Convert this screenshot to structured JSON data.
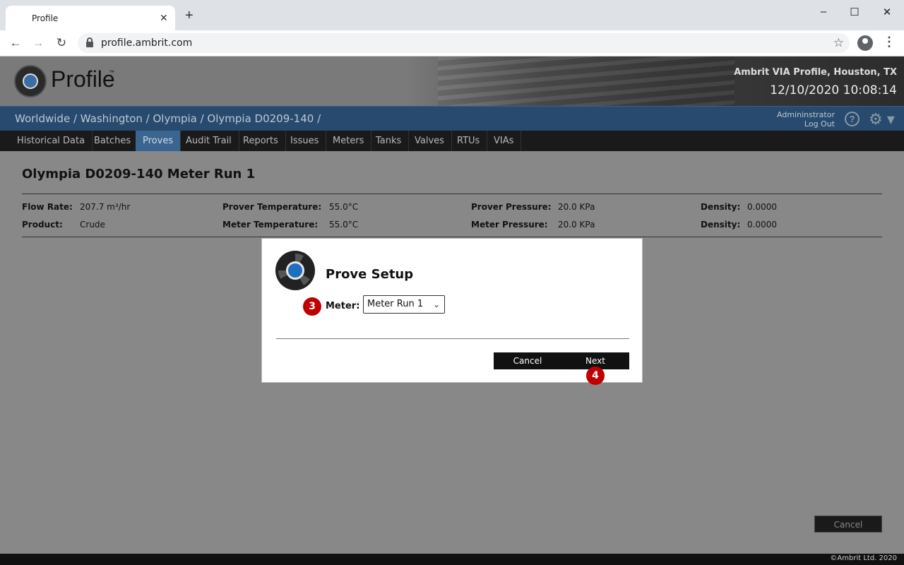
{
  "browser": {
    "tab_title": "Profile",
    "tab_close": "✕",
    "new_tab": "+",
    "url": "profile.ambrit.com",
    "window_controls": {
      "minimize": "–",
      "maximize": "☐",
      "close": "✕"
    },
    "nav": {
      "back": "←",
      "forward": "→",
      "reload": "↻"
    },
    "star": "☆",
    "menu": "⋮"
  },
  "header": {
    "logo_text": "Profile",
    "logo_tm": "™",
    "site_name": "Ambrit VIA Profile, Houston, TX",
    "datetime": "12/10/2020 10:08:14"
  },
  "breadcrumb": "Worldwide / Washington / Olympia / Olympia D0209-140 /",
  "user": {
    "name": "Admininstrator",
    "logout": "Log Out",
    "help": "?",
    "gear": "⚙ ▾"
  },
  "menu": [
    {
      "label": "Historical Data",
      "active": false
    },
    {
      "label": "Batches",
      "active": false
    },
    {
      "label": "Proves",
      "active": true
    },
    {
      "label": "Audit Trail",
      "active": false
    },
    {
      "label": "Reports",
      "active": false
    },
    {
      "label": "Issues",
      "active": false
    },
    {
      "label": "Meters",
      "active": false
    },
    {
      "label": "Tanks",
      "active": false
    },
    {
      "label": "Valves",
      "active": false
    },
    {
      "label": "RTUs",
      "active": false
    },
    {
      "label": "VIAs",
      "active": false
    }
  ],
  "page": {
    "title": "Olympia D0209-140 Meter Run 1",
    "fields": {
      "flow_rate": {
        "label": "Flow Rate:",
        "value": "207.7 m³/hr"
      },
      "product": {
        "label": "Product:",
        "value": "Crude"
      },
      "prover_temperature": {
        "label": "Prover Temperature:",
        "value": "55.0°C"
      },
      "meter_temperature": {
        "label": "Meter Temperature:",
        "value": "55.0°C"
      },
      "prover_pressure": {
        "label": "Prover Pressure:",
        "value": "20.0 KPa"
      },
      "meter_pressure": {
        "label": "Meter Pressure:",
        "value": "20.0 KPa"
      },
      "density_1": {
        "label": "Density:",
        "value": "0.0000"
      },
      "density_2": {
        "label": "Density:",
        "value": "0.0000"
      }
    },
    "cancel_label": "Cancel"
  },
  "modal": {
    "title": "Prove Setup",
    "meter_label": "Meter:",
    "meter_value": "Meter Run 1",
    "chevron": "⌄",
    "cancel_label": "Cancel",
    "next_label": "Next",
    "step_badges": [
      "3",
      "4"
    ]
  },
  "footer": {
    "copyright": "©Ambrit Ltd. 2020"
  },
  "colors": {
    "badge": "#c00000",
    "active_menu": "#3a6590",
    "crumb_bar": "#274a6e"
  }
}
